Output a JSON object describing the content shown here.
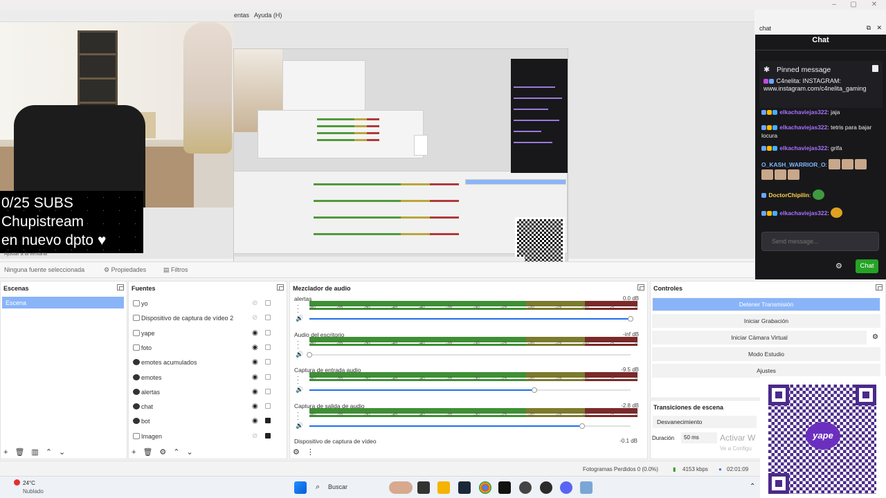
{
  "window": {
    "menu": [
      {
        "label": "entas"
      },
      {
        "label": "Ayuda (H)"
      }
    ]
  },
  "overlay": {
    "subs_line1": "0/25 SUBS",
    "subs_line2": "Chupistream",
    "subs_line3": "en nuevo dpto ♥"
  },
  "preview": {
    "dock_hint": "Ajustar a la ventana"
  },
  "source_toolbar": {
    "no_source": "Ninguna fuente seleccionada",
    "properties": "Propiedades",
    "filters": "Filtros"
  },
  "scenes": {
    "title": "Escenas",
    "items": [
      "Escena"
    ]
  },
  "sources": {
    "title": "Fuentes",
    "items": [
      {
        "label": "yo",
        "visible": false,
        "locked": false
      },
      {
        "label": "Dispositivo de captura de vídeo 2",
        "visible": false,
        "locked": false
      },
      {
        "label": "yape",
        "visible": true,
        "locked": false
      },
      {
        "label": "foto",
        "visible": true,
        "locked": false
      },
      {
        "label": "emotes acumulados",
        "visible": true,
        "locked": false
      },
      {
        "label": "emotes",
        "visible": true,
        "locked": false
      },
      {
        "label": "alertas",
        "visible": true,
        "locked": false
      },
      {
        "label": "chat",
        "visible": true,
        "locked": false
      },
      {
        "label": "bot",
        "visible": true,
        "locked": true
      },
      {
        "label": "Imagen",
        "visible": false,
        "locked": true
      }
    ]
  },
  "mixer": {
    "title": "Mezclador de audio",
    "ticks": [
      "-60",
      "-55",
      "-50",
      "-45",
      "-40",
      "-35",
      "-30",
      "-25",
      "-20",
      "-15",
      "-10",
      "-5",
      "0"
    ],
    "channels": [
      {
        "name": "alertas",
        "db": "0.0 dB",
        "volume": 1.0
      },
      {
        "name": "Audio del escritorio",
        "db": "-inf dB",
        "volume": 0.0
      },
      {
        "name": "Captura de entrada audio",
        "db": "-9.5 dB",
        "volume": 0.7
      },
      {
        "name": "Captura de salida de audio",
        "db": "-2.8 dB",
        "volume": 0.85
      }
    ],
    "last_channel": "Dispositivo de captura de vídeo",
    "last_db": "-0.1 dB"
  },
  "controls": {
    "title": "Controles",
    "buttons": [
      "Detener Transmisión",
      "Iniciar Grabación",
      "Iniciar Cámara Virtual",
      "Modo Estudio",
      "Ajustes"
    ]
  },
  "transitions": {
    "title": "Transiciones de escena",
    "selected": "Desvanecimiento",
    "duration_label": "Duración",
    "duration_value": "50 ms"
  },
  "chat": {
    "dock_title": "chat",
    "title": "Chat",
    "pinned_title": "Pinned message",
    "pinned_user": "C4nelita",
    "pinned_text": ": INSTAGRAM: www.instagram.com/c4nelita_gaming",
    "messages": [
      {
        "user": "elkachaviejas322",
        "text": ": jaja"
      },
      {
        "user": "elkachaviejas322",
        "text": ": tetris para bajar locura"
      },
      {
        "user": "elkachaviejas322",
        "text": ": grifa"
      },
      {
        "user": "O_KASH_WARRIOR_O",
        "text": ":"
      },
      {
        "user": "DoctorChipilin",
        "text": ":"
      },
      {
        "user": "elkachaviejas322",
        "text": ":"
      }
    ],
    "input_placeholder": "Send message...",
    "send_label": "Chat"
  },
  "statusbar": {
    "dropped": "Fotogramas Perdidos 0 (0.0%)",
    "bitrate": "4153 kbps",
    "time": "02:01:09"
  },
  "watermark": {
    "line1": "Activar W",
    "line2": "Ve a Configu"
  },
  "qr_logo": "yape",
  "taskbar": {
    "weather_temp": "24°C",
    "weather_desc": "Nublado",
    "search_label": "Buscar"
  }
}
